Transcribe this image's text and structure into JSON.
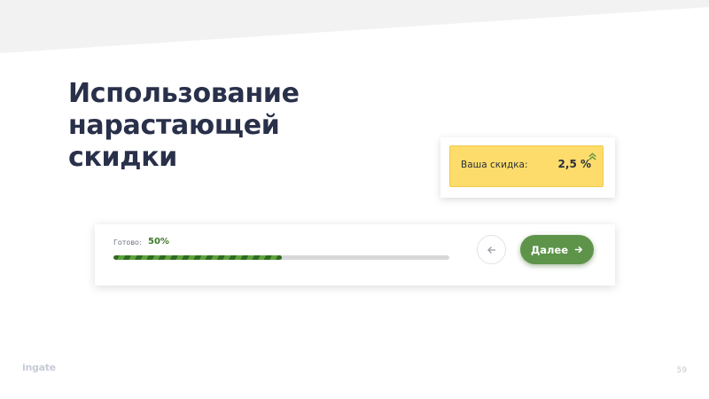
{
  "slide": {
    "title_lines": [
      "Использование",
      "нарастающей",
      "скидки"
    ],
    "page_number": "59",
    "logo_text": "ingate"
  },
  "discount_widget": {
    "label": "Ваша скидка:",
    "value": "2,5 %",
    "trend_icon": "double-chevron-up-icon",
    "colors": {
      "background": "#fedc6b",
      "trend": "#5e944a"
    }
  },
  "progress_widget": {
    "caption": "Готово:",
    "percent_text": "50%",
    "progress_fraction": 0.5,
    "back_icon": "arrow-left-icon",
    "next_label": "Далее",
    "next_icon": "arrow-right-icon",
    "colors": {
      "accent": "#5e944a",
      "percent_text": "#3f7a2a"
    }
  },
  "theme": {
    "title_color": "#29304a",
    "top_band_color": "#f2f2f2"
  }
}
